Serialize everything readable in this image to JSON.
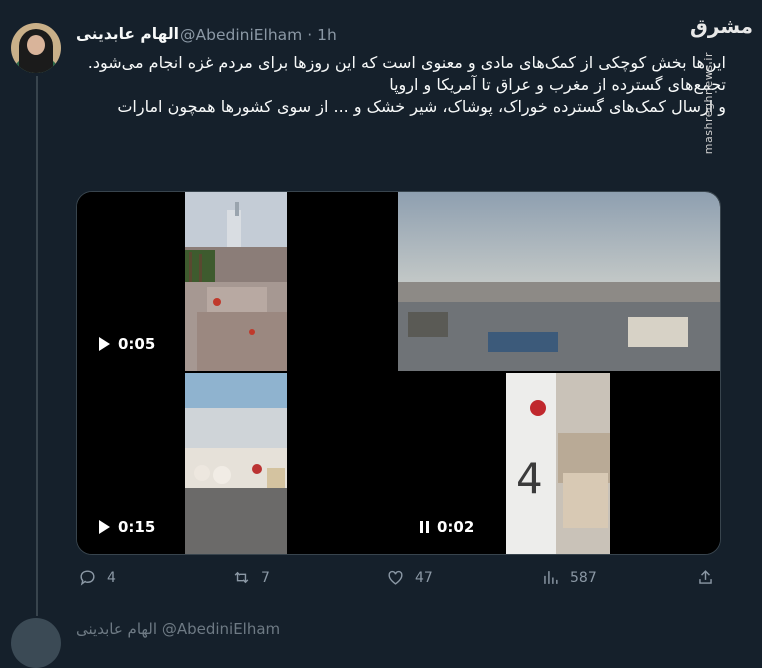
{
  "tweet": {
    "name": "الهام عابدینی",
    "handle": "@AbediniElham",
    "dot": "·",
    "time": "1h",
    "lines": [
      "این‌ها بخش کوچکی از کمک‌های مادی و معنوی است که این روزها برای مردم غزه انجام می‌شود.",
      "تجمع‌های گسترده از مغرب و عراق تا آمریکا و اروپا",
      "و ارسال کمک‌های گسترده خوراک، پوشاک، شیر خشک و ... از سوی کشورها همچون امارات"
    ]
  },
  "watermark": {
    "logo": "مشرق",
    "url": "mashreghnews.ir"
  },
  "media": [
    {
      "duration": "0:05",
      "state": "play"
    },
    {
      "duration": "",
      "state": "none"
    },
    {
      "duration": "0:15",
      "state": "play"
    },
    {
      "duration": "0:02",
      "state": "pause"
    }
  ],
  "actions": {
    "replies": "4",
    "retweets": "7",
    "likes": "47",
    "views": "587"
  },
  "next_tweet": {
    "partial_text": "الهام عابدینی @AbediniElham"
  },
  "icons": [
    "reply-icon",
    "retweet-icon",
    "like-icon",
    "views-icon",
    "share-icon"
  ]
}
